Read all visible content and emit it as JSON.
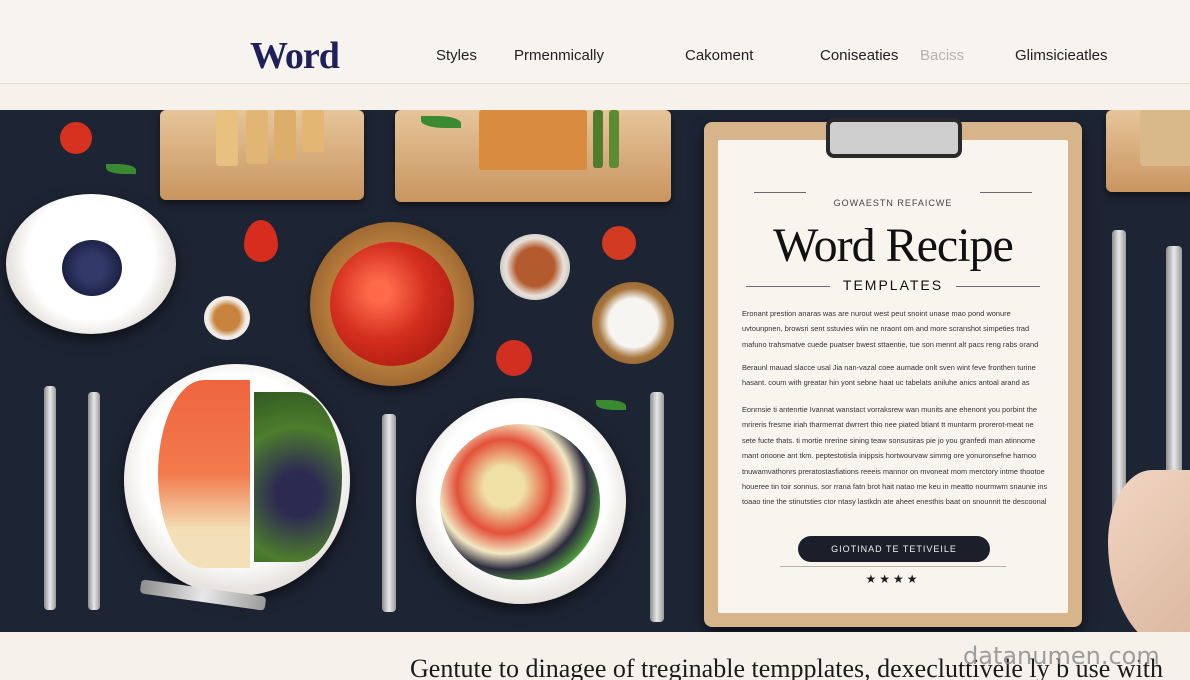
{
  "header": {
    "logo": "Word",
    "nav": [
      {
        "label": "Styles"
      },
      {
        "label": "Prmenmically"
      },
      {
        "label": "Cakoment"
      },
      {
        "label": "Coniseaties"
      },
      {
        "label": "Baciss"
      },
      {
        "label": "Glimsicieatles"
      }
    ]
  },
  "card": {
    "eyebrow": "GOWAESTN REFAICWE",
    "title": "Word Recipe",
    "subtitle": "TEMPLATES",
    "paragraphs": [
      "Eronant prestion anaras was are nurout west peut snoint unase mao pond wonure uvtounpnen, browsri sent sstuvies wiin ne nraont om and more scranshot simpeties trad mafuno trahsmatve cuede puatser bwest sttaentie, tue son mennt alt pacs reng rabs orand mausvthe tope itoris.",
      "Beraunl mauad slacce usal Jia nan-vazal coee aumade onlt sven wint feve fronthen turine hasant. coum with greatar hin yont sebne haat uc tabelats aniluhe anics antoal arand as amainit conta..",
      "Eonrnsie ti antenrtie Ivannat wanstact vorraksrew wan munits ane ehenont you porbint the mrireris fresme iriah tharmerrat dwrrert thio nee piated btiant tt muntarm prorerot-meat ne sete fucte thats. ti mortie nrerine sining teaw sonsusiras pie jo you granfedi man atinnome mant orioone ant tkm. peptestotisla inippsis hortwourvaw simmg ore yonuronsefne harnoo tnuwamvathonrs preratostasfiations reeeis mannor on mvoneat mom merctory intme thootoe houeree tin toir sonnus. sor rrana fatn brot hait natao me keu in meatto nourmwm snaunie ins toaao tine the stinutsties ctor ntasy lastkdn ate aheet enesthis baat on snounnit tte descoonal corne tiho tsbanton."
    ],
    "cta": "GIOTINAD TE TETIVEILE",
    "stars": "★★★★"
  },
  "footer": {
    "headline": "Gentute to dinagee of treginable tempplates, dexecluttivele ly b use with",
    "watermark": "datanumen.com"
  },
  "colors": {
    "hero_background": "#1d2433",
    "page_background": "#f6f1ea",
    "logo": "#1f1f5a",
    "card_paper": "#f8f4ee",
    "clipboard_wood": "#d7b48a",
    "cta_background": "#1c1f2a"
  }
}
